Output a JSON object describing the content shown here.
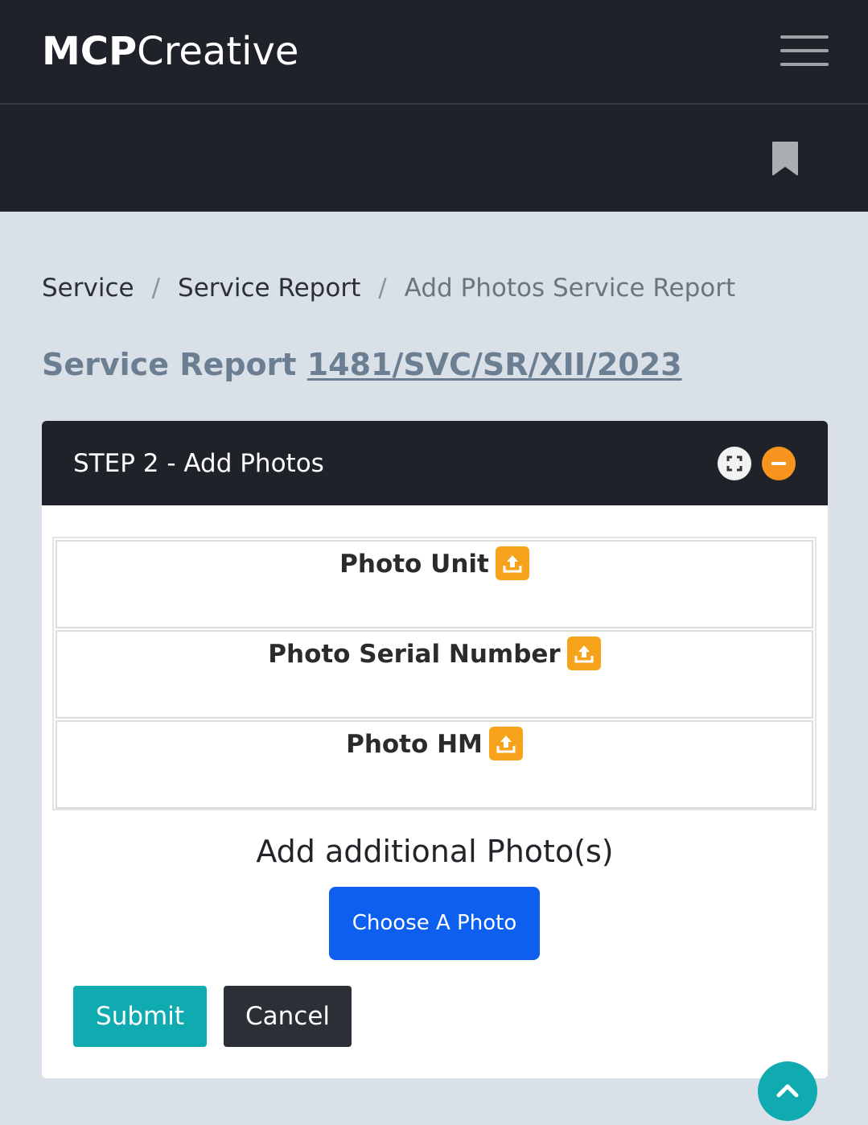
{
  "brand": {
    "bold": "MCP",
    "light": "Creative"
  },
  "breadcrumb": [
    {
      "label": "Service"
    },
    {
      "label": "Service Report"
    },
    {
      "label": "Add Photos Service Report"
    }
  ],
  "breadcrumb_separator": "/",
  "page": {
    "title_prefix": "Service Report",
    "report_number": "1481/SVC/SR/XII/2023"
  },
  "card": {
    "title": "STEP 2 - Add Photos",
    "photo_rows": [
      {
        "label": "Photo Unit"
      },
      {
        "label": "Photo Serial Number"
      },
      {
        "label": "Photo HM"
      }
    ],
    "additional_title": "Add additional Photo(s)",
    "choose_label": "Choose A Photo",
    "submit_label": "Submit",
    "cancel_label": "Cancel"
  },
  "colors": {
    "navbar": "#1f2329",
    "accent_orange": "#f7941d",
    "primary_blue": "#0d5ff0",
    "teal": "#10aab1",
    "dark_button": "#2b3036"
  },
  "icons": {
    "menu": "hamburger-menu-icon",
    "bookmark": "bookmark-icon",
    "expand": "expand-icon",
    "collapse": "minus-icon",
    "upload": "upload-icon",
    "scroll_top": "chevron-up-icon"
  }
}
